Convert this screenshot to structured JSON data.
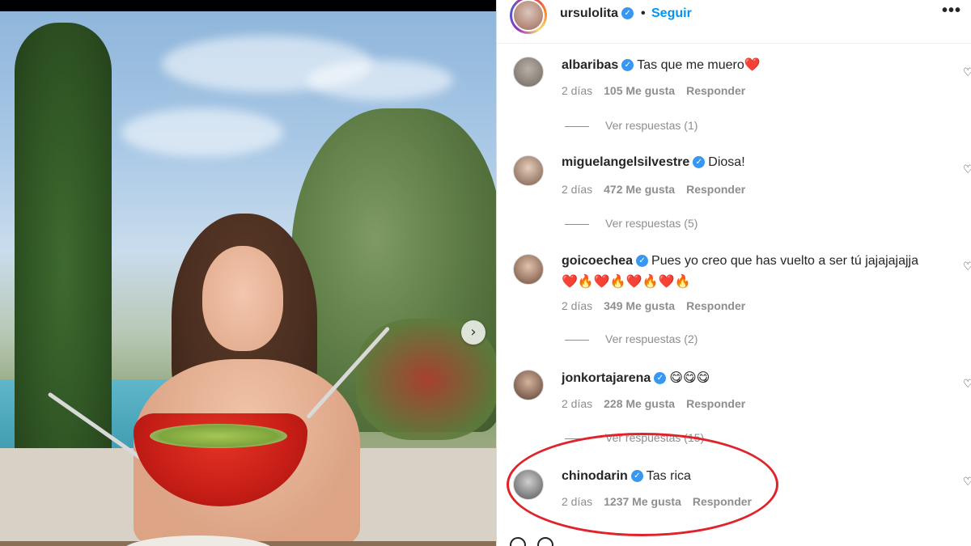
{
  "post": {
    "username": "ursulolita",
    "follow_label": "Seguir",
    "separator": "•",
    "more_label": "•••",
    "next_label": "›",
    "verified_mark": "✓"
  },
  "comments": [
    {
      "user": "albaribas",
      "text": "Tas que me muero❤️",
      "text2": "",
      "age": "2 días",
      "likes": "105 Me gusta",
      "reply": "Responder",
      "replies": "Ver respuestas (1)"
    },
    {
      "user": "miguelangelsilvestre",
      "text": "Diosa!",
      "text2": "",
      "age": "2 días",
      "likes": "472 Me gusta",
      "reply": "Responder",
      "replies": "Ver respuestas (5)"
    },
    {
      "user": "goicoechea",
      "text": "Pues yo creo que has vuelto a ser tú jajajajajja",
      "text2": "❤️🔥❤️🔥❤️🔥❤️🔥",
      "age": "2 días",
      "likes": "349 Me gusta",
      "reply": "Responder",
      "replies": "Ver respuestas (2)"
    },
    {
      "user": "jonkortajarena",
      "text": "😋😋😋",
      "text2": "",
      "age": "2 días",
      "likes": "228 Me gusta",
      "reply": "Responder",
      "replies": "Ver respuestas (15)"
    },
    {
      "user": "chinodarin",
      "text": "Tas rica",
      "text2": "",
      "age": "2 días",
      "likes": "1237 Me gusta",
      "reply": "Responder",
      "replies": ""
    }
  ],
  "icons": {
    "heart": "heart-outline-icon",
    "next": "chevron-right-icon",
    "more": "more-horizontal-icon",
    "verified": "verified-badge-icon"
  },
  "colors": {
    "accent": "#0095f6",
    "verified": "#3897f0",
    "highlight": "#e0232b",
    "muted_text": "#8e8e8e"
  }
}
